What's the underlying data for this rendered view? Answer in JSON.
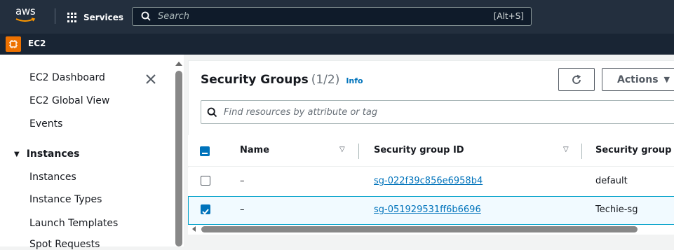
{
  "topbar": {
    "logo_text": "aws",
    "services_label": "Services",
    "search_placeholder": "Search",
    "search_shortcut": "[Alt+S]"
  },
  "service_bar": {
    "label": "EC2"
  },
  "sidebar": {
    "items": [
      {
        "label": "EC2 Dashboard"
      },
      {
        "label": "EC2 Global View"
      },
      {
        "label": "Events"
      }
    ],
    "section": {
      "label": "Instances",
      "expanded": true
    },
    "section_items": [
      {
        "label": "Instances"
      },
      {
        "label": "Instance Types"
      },
      {
        "label": "Launch Templates"
      },
      {
        "label": "Spot Requests"
      }
    ]
  },
  "main": {
    "title": "Security Groups",
    "count": "(1/2)",
    "info": "Info",
    "actions_label": "Actions",
    "filter_placeholder": "Find resources by attribute or tag",
    "columns": [
      "Name",
      "Security group ID",
      "Security group n"
    ],
    "rows": [
      {
        "name": "–",
        "id": "sg-022f39c856e6958b4",
        "group_name": "default",
        "selected": false
      },
      {
        "name": "–",
        "id": "sg-051929531ff6b6696",
        "group_name": "Techie-sg",
        "selected": true
      }
    ]
  },
  "colors": {
    "topbar": "#232f3e",
    "accent": "#0073bb",
    "ec2_orange": "#ed7100"
  }
}
